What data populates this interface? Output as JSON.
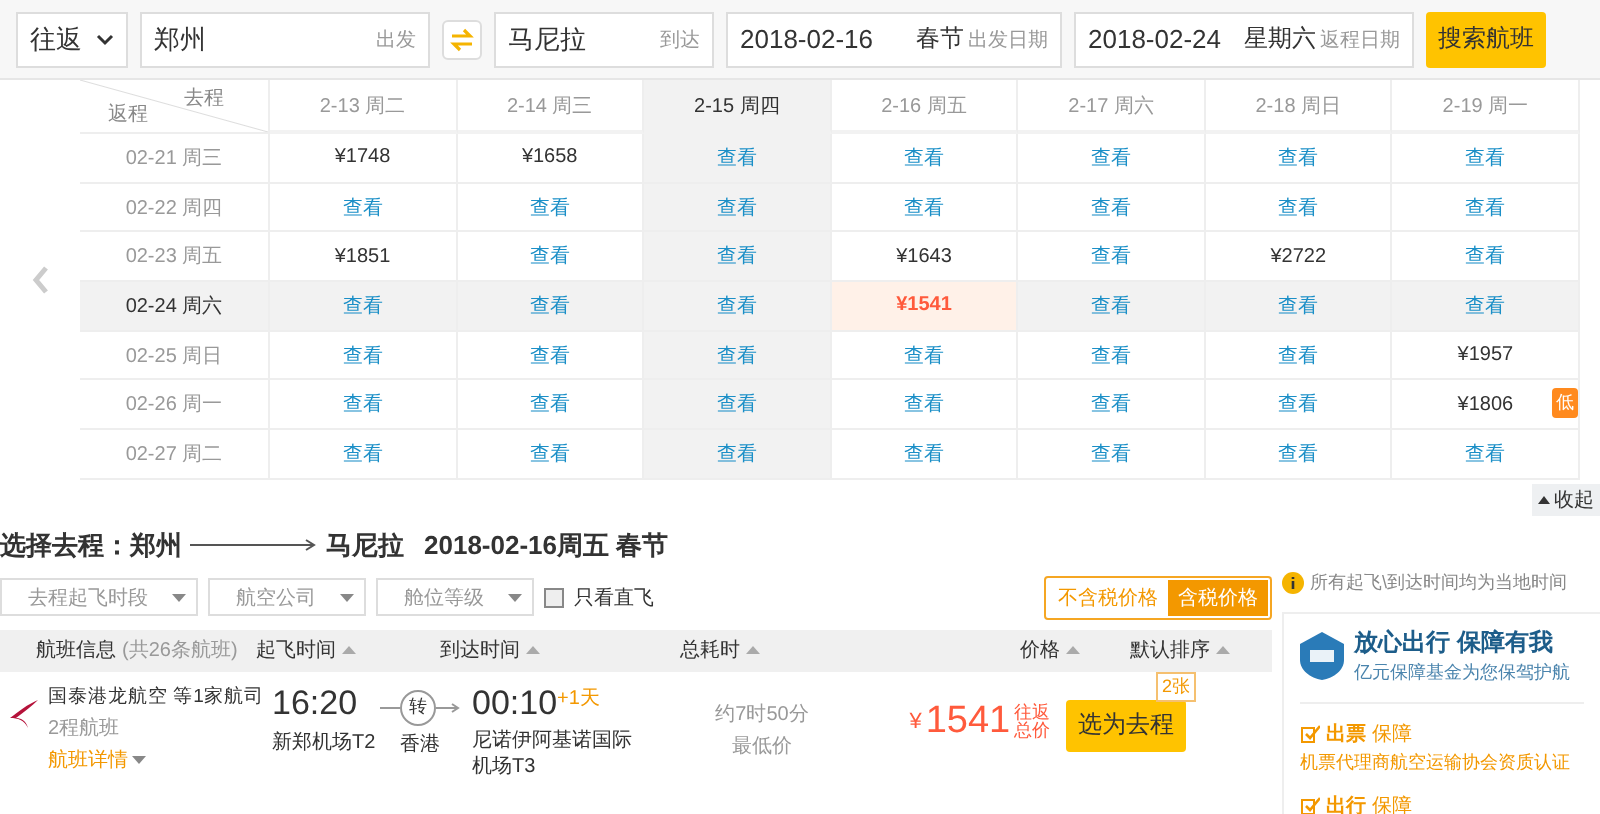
{
  "search": {
    "trip_type": "往返",
    "from": {
      "value": "郑州",
      "hint": "出发"
    },
    "to": {
      "value": "马尼拉",
      "hint": "到达"
    },
    "depart": {
      "value": "2018-02-16",
      "note": "春节",
      "hint": "出发日期"
    },
    "return": {
      "value": "2018-02-24",
      "note": "星期六",
      "hint": "返程日期"
    },
    "button": "搜索航班"
  },
  "grid": {
    "corner_depart": "去程",
    "corner_return": "返程",
    "columns": [
      {
        "label": "2-13 周二",
        "selected": false
      },
      {
        "label": "2-14 周三",
        "selected": false
      },
      {
        "label": "2-15 周四",
        "selected": true
      },
      {
        "label": "2-16 周五",
        "selected": false
      },
      {
        "label": "2-17 周六",
        "selected": false
      },
      {
        "label": "2-18 周日",
        "selected": false
      },
      {
        "label": "2-19 周一",
        "selected": false
      }
    ],
    "rows": [
      {
        "label": "02-21 周三",
        "selected": false,
        "cells": [
          {
            "text": "¥1748",
            "kind": "price",
            "selected": false
          },
          {
            "text": "¥1658",
            "kind": "price",
            "selected": false
          },
          {
            "text": "查看",
            "kind": "link",
            "selected": false
          },
          {
            "text": "查看",
            "kind": "link",
            "selected": false
          },
          {
            "text": "查看",
            "kind": "link",
            "selected": false
          },
          {
            "text": "查看",
            "kind": "link",
            "selected": false
          },
          {
            "text": "查看",
            "kind": "link",
            "selected": false
          }
        ]
      },
      {
        "label": "02-22 周四",
        "selected": false,
        "cells": [
          {
            "text": "查看",
            "kind": "link",
            "selected": false
          },
          {
            "text": "查看",
            "kind": "link",
            "selected": false
          },
          {
            "text": "查看",
            "kind": "link",
            "selected": false
          },
          {
            "text": "查看",
            "kind": "link",
            "selected": false
          },
          {
            "text": "查看",
            "kind": "link",
            "selected": false
          },
          {
            "text": "查看",
            "kind": "link",
            "selected": false
          },
          {
            "text": "查看",
            "kind": "link",
            "selected": false
          }
        ]
      },
      {
        "label": "02-23 周五",
        "selected": false,
        "cells": [
          {
            "text": "¥1851",
            "kind": "price",
            "selected": false
          },
          {
            "text": "查看",
            "kind": "link",
            "selected": false
          },
          {
            "text": "查看",
            "kind": "link",
            "selected": false
          },
          {
            "text": "¥1643",
            "kind": "price",
            "selected": false
          },
          {
            "text": "查看",
            "kind": "link",
            "selected": false
          },
          {
            "text": "¥2722",
            "kind": "price",
            "selected": false
          },
          {
            "text": "查看",
            "kind": "link",
            "selected": false
          }
        ]
      },
      {
        "label": "02-24 周六",
        "selected": true,
        "cells": [
          {
            "text": "查看",
            "kind": "link",
            "selected": false
          },
          {
            "text": "查看",
            "kind": "link",
            "selected": false
          },
          {
            "text": "查看",
            "kind": "link",
            "selected": false
          },
          {
            "text": "¥1541",
            "kind": "price",
            "selected": true
          },
          {
            "text": "查看",
            "kind": "link",
            "selected": false
          },
          {
            "text": "查看",
            "kind": "link",
            "selected": false
          },
          {
            "text": "查看",
            "kind": "link",
            "selected": false
          }
        ]
      },
      {
        "label": "02-25 周日",
        "selected": false,
        "cells": [
          {
            "text": "查看",
            "kind": "link",
            "selected": false
          },
          {
            "text": "查看",
            "kind": "link",
            "selected": false
          },
          {
            "text": "查看",
            "kind": "link",
            "selected": false
          },
          {
            "text": "查看",
            "kind": "link",
            "selected": false
          },
          {
            "text": "查看",
            "kind": "link",
            "selected": false
          },
          {
            "text": "查看",
            "kind": "link",
            "selected": false
          },
          {
            "text": "¥1957",
            "kind": "price",
            "selected": false
          }
        ]
      },
      {
        "label": "02-26 周一",
        "selected": false,
        "cells": [
          {
            "text": "查看",
            "kind": "link",
            "selected": false
          },
          {
            "text": "查看",
            "kind": "link",
            "selected": false
          },
          {
            "text": "查看",
            "kind": "link",
            "selected": false
          },
          {
            "text": "查看",
            "kind": "link",
            "selected": false
          },
          {
            "text": "查看",
            "kind": "link",
            "selected": false
          },
          {
            "text": "查看",
            "kind": "link",
            "selected": false
          },
          {
            "text": "¥1806",
            "kind": "price",
            "selected": false,
            "badge": "低"
          }
        ]
      },
      {
        "label": "02-27 周二",
        "selected": false,
        "cells": [
          {
            "text": "查看",
            "kind": "link",
            "selected": false
          },
          {
            "text": "查看",
            "kind": "link",
            "selected": false
          },
          {
            "text": "查看",
            "kind": "link",
            "selected": false
          },
          {
            "text": "查看",
            "kind": "link",
            "selected": false
          },
          {
            "text": "查看",
            "kind": "link",
            "selected": false
          },
          {
            "text": "查看",
            "kind": "link",
            "selected": false
          },
          {
            "text": "查看",
            "kind": "link",
            "selected": false
          }
        ]
      }
    ],
    "collapse": "收起"
  },
  "results": {
    "heading": {
      "label": "选择去程：郑州",
      "to": "马尼拉",
      "date": "2018-02-16周五 春节"
    },
    "filters": [
      "去程起飞时段",
      "航空公司",
      "舱位等级"
    ],
    "direct_only": {
      "label": "只看直飞",
      "checked": false
    },
    "tax_toggle": [
      {
        "label": "不含税价格",
        "selected": false
      },
      {
        "label": "含税价格",
        "selected": true
      }
    ],
    "columns": {
      "info": "航班信息",
      "count": "(共26条航班)",
      "depart": "起飞时间",
      "arrive": "到达时间",
      "duration": "总耗时",
      "price": "价格",
      "sort": "默认排序"
    },
    "flights": [
      {
        "airline": "国泰港龙航空 等1家航司",
        "legs": "2程航班",
        "details": "航班详情",
        "depart_time": "16:20",
        "depart_airport": "新郑机场T2",
        "transfer": "转",
        "transfer_city": "香港",
        "arrive_time": "00:10",
        "next_day": "+1天",
        "arrive_airport": "尼诺伊阿基诺国际机场T3",
        "duration": "约7时50分",
        "note": "最低价",
        "currency": "¥",
        "price": "1541",
        "price_note": "往返总价",
        "button": "选为去程",
        "seats": "2张"
      }
    ]
  },
  "side": {
    "notice": "所有起飞\\到达时间均为当地时间",
    "card": {
      "title": "放心出行 保障有我",
      "subtitle": "亿元保障基金为您保驾护航",
      "items": [
        {
          "title": "出票",
          "tag": "保障",
          "desc": "机票代理商航空运输协会资质认证"
        },
        {
          "title": "出行",
          "tag": "保障"
        }
      ]
    }
  }
}
